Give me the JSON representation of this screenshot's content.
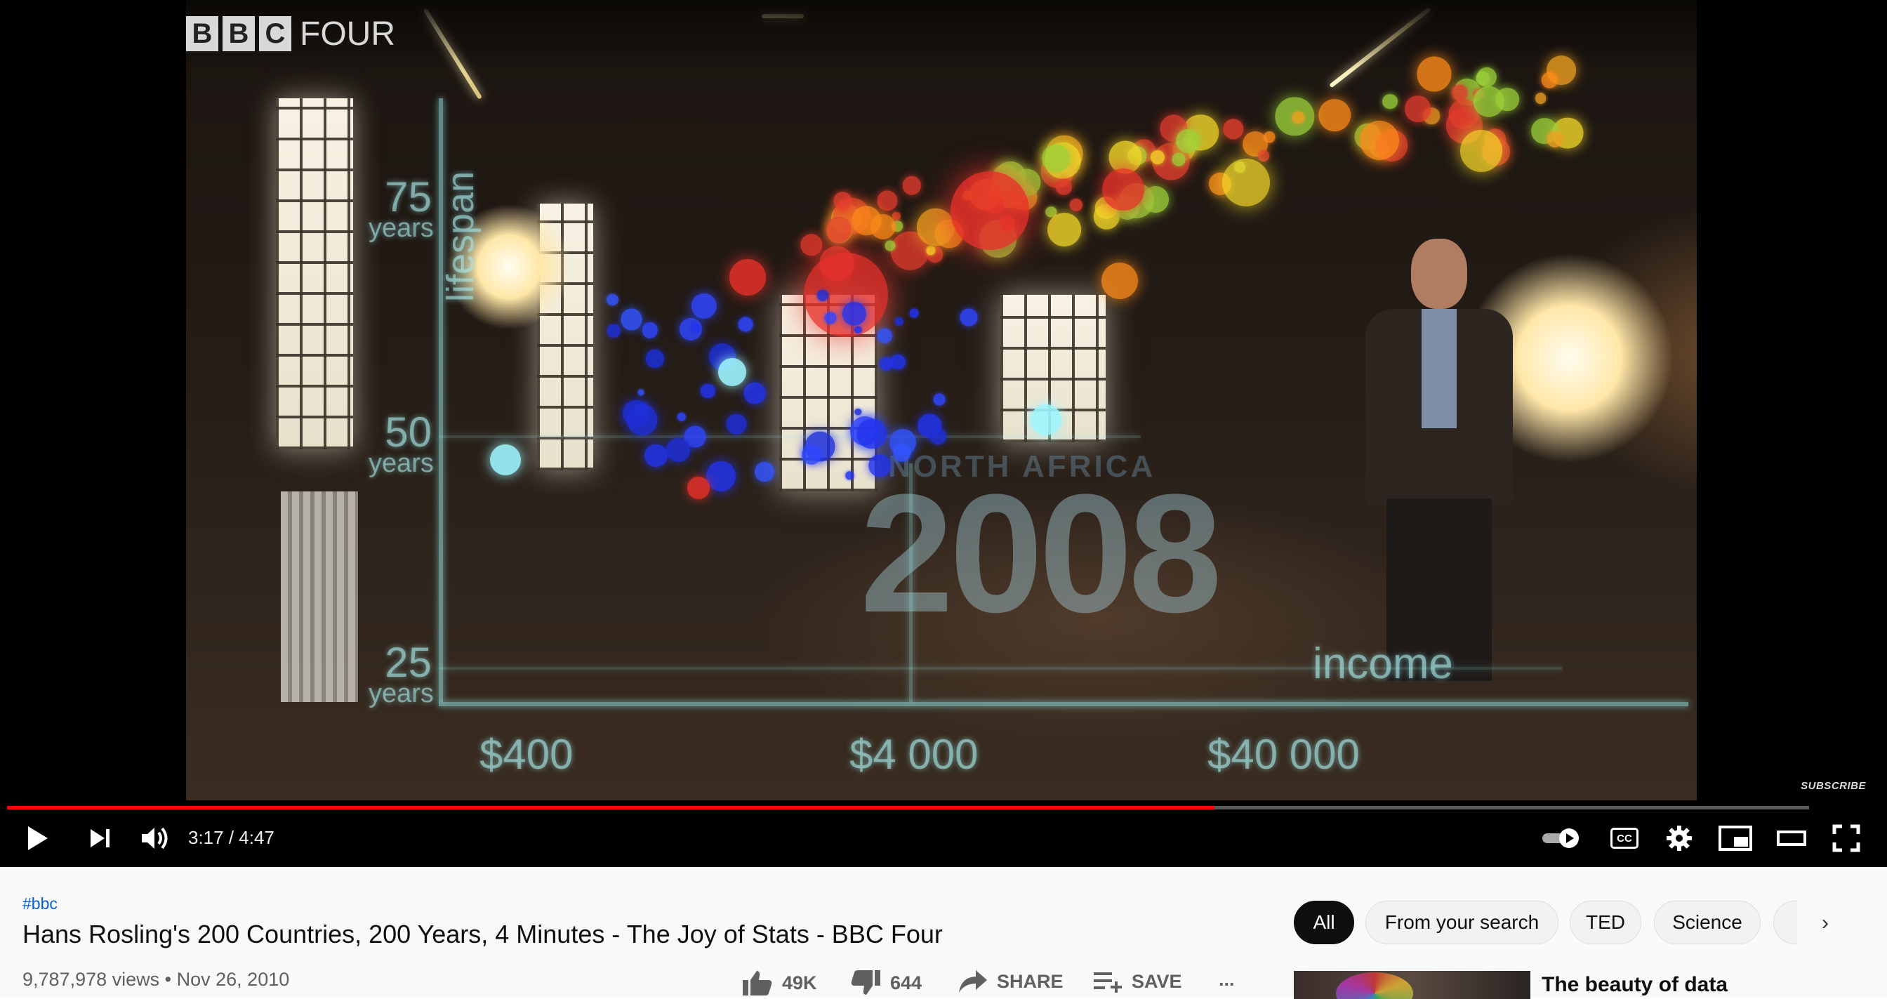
{
  "video": {
    "logo_letters": [
      "B",
      "B",
      "C"
    ],
    "logo_text": "FOUR",
    "overlay": {
      "y_axis_label": "lifespan",
      "x_axis_label": "income",
      "y_ticks": [
        {
          "value": "75",
          "unit": "years"
        },
        {
          "value": "50",
          "unit": "years"
        },
        {
          "value": "25",
          "unit": "years"
        }
      ],
      "x_ticks": [
        "$400",
        "$4 000",
        "$40 000"
      ],
      "year": "2008",
      "region_label": "NORTH AFRICA"
    },
    "subscribe_label": "SUBSCRIBE",
    "progress_fraction": 0.67
  },
  "controls": {
    "play_icon": "play-icon",
    "next_icon": "next-icon",
    "volume_icon": "volume-icon",
    "time": "3:17 / 4:47",
    "autoplay_icon": "autoplay-toggle-icon",
    "cc_label": "CC",
    "settings_icon": "gear-icon",
    "miniplayer_icon": "miniplayer-icon",
    "theater_icon": "theater-icon",
    "fullscreen_icon": "fullscreen-icon"
  },
  "info": {
    "hashtag": "#bbc",
    "title": "Hans Rosling's 200 Countries, 200 Years, 4 Minutes - The Joy of Stats - BBC Four",
    "views": "9,787,978 views",
    "separator": "•",
    "date": "Nov 26, 2010",
    "likes": "49K",
    "dislikes": "644",
    "share": "SHARE",
    "save": "SAVE",
    "more": "..."
  },
  "chips": [
    "All",
    "From your search",
    "TED",
    "Science"
  ],
  "chip_next": "›",
  "recommendation": {
    "title": "The beauty of data"
  },
  "colors": {
    "progress_played": "#ff0000",
    "link": "#065fd4",
    "chip_active": "#0f0f0f"
  }
}
